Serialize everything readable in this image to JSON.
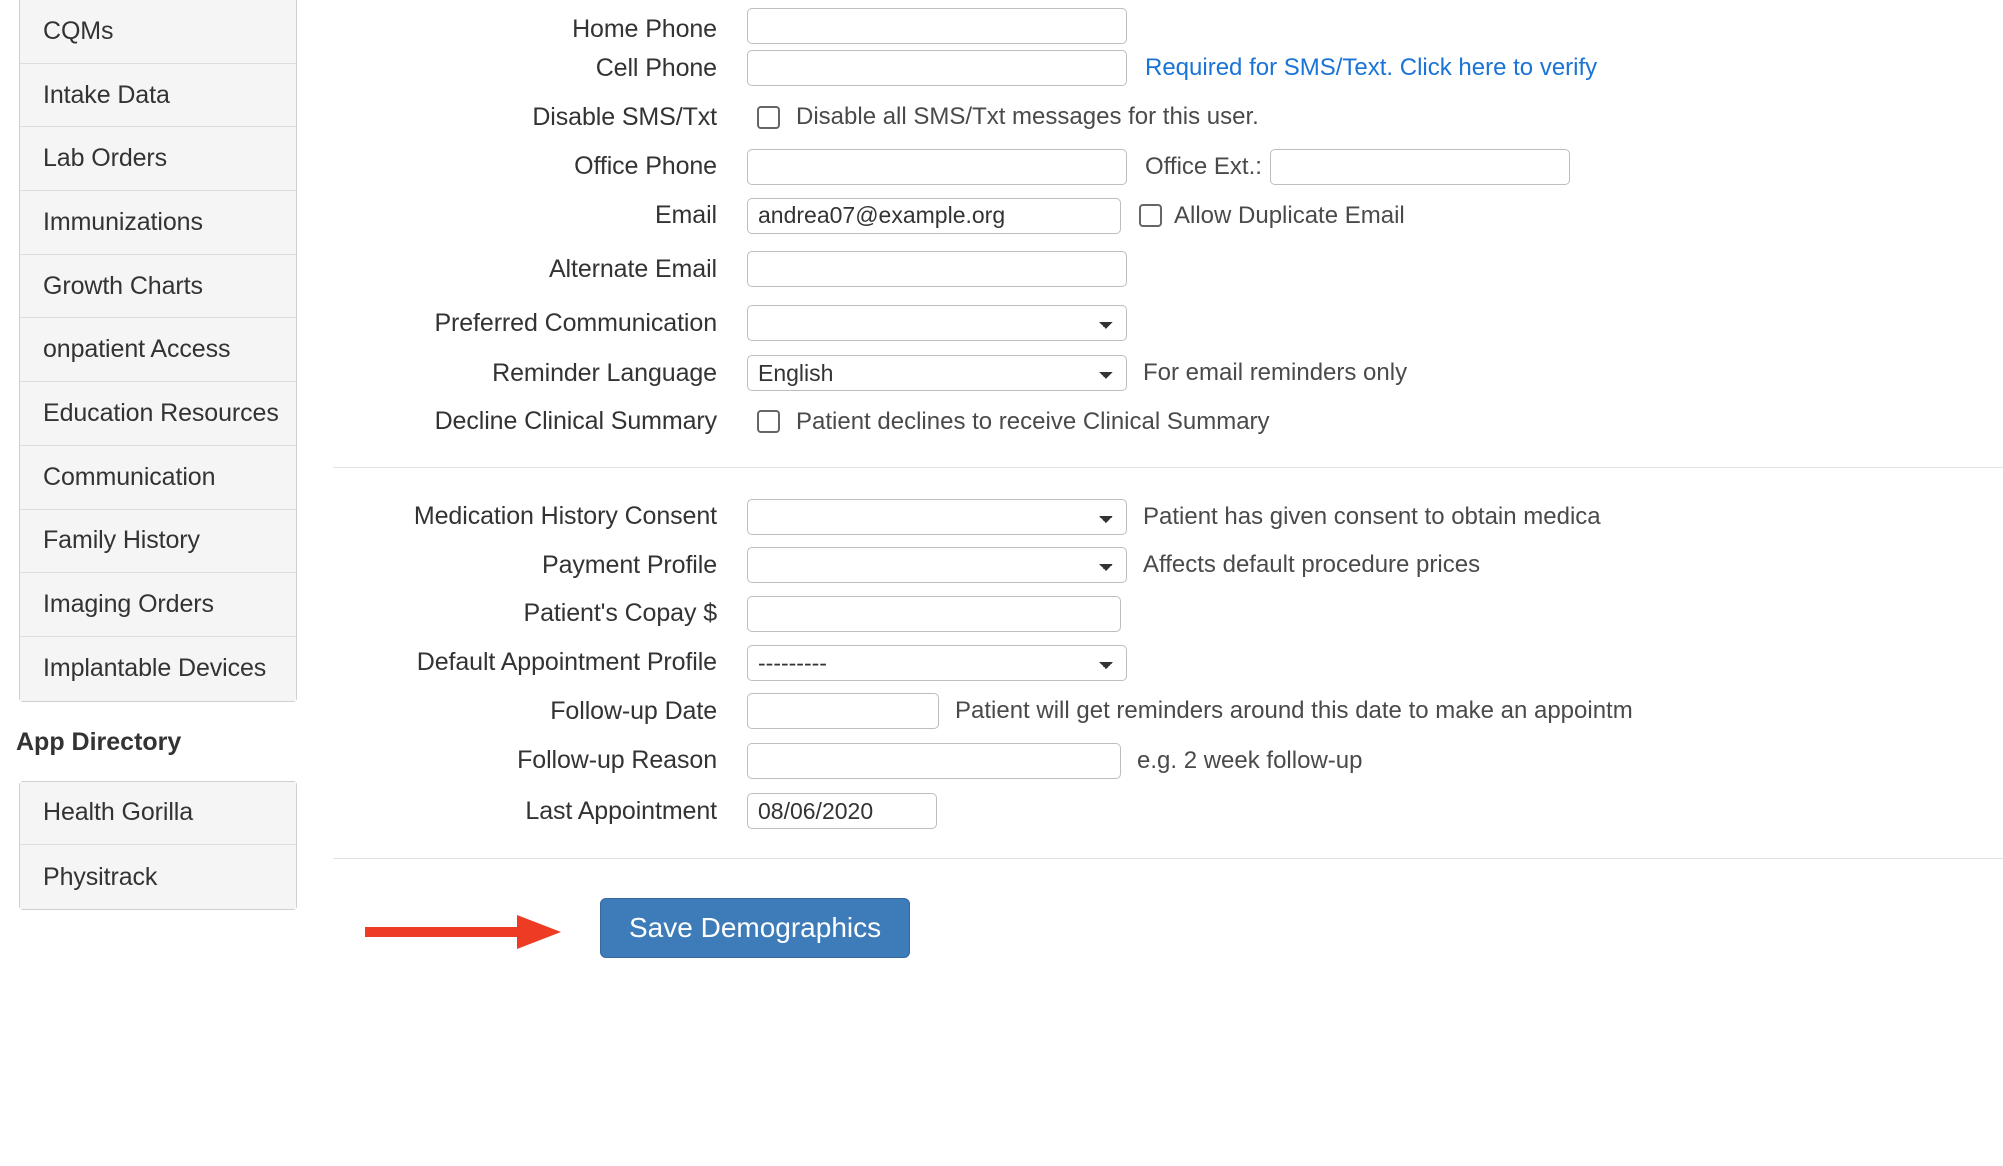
{
  "sidebar": {
    "nav_items": [
      {
        "label": "CQMs"
      },
      {
        "label": "Intake Data"
      },
      {
        "label": "Lab Orders"
      },
      {
        "label": "Immunizations"
      },
      {
        "label": "Growth Charts"
      },
      {
        "label": "onpatient Access"
      },
      {
        "label": "Education Resources"
      },
      {
        "label": "Communication"
      },
      {
        "label": "Family History"
      },
      {
        "label": "Imaging Orders"
      },
      {
        "label": "Implantable Devices"
      }
    ],
    "app_directory_title": "App Directory",
    "app_items": [
      {
        "label": "Health Gorilla"
      },
      {
        "label": "Physitrack"
      }
    ]
  },
  "form": {
    "home_phone": {
      "label": "Home Phone",
      "value": "",
      "placeholder": ""
    },
    "cell_phone": {
      "label": "Cell Phone",
      "value": "",
      "placeholder": "",
      "link": "Required for SMS/Text. Click here to verify"
    },
    "disable_sms": {
      "label": "Disable SMS/Txt",
      "checkbox_label": "Disable all SMS/Txt messages for this user.",
      "checked": false
    },
    "office_phone": {
      "label": "Office Phone",
      "value": "",
      "ext_label": "Office Ext.:",
      "ext_value": ""
    },
    "email": {
      "label": "Email",
      "value": "andrea07@example.org",
      "duplicate_label": "Allow Duplicate Email",
      "duplicate_checked": false
    },
    "alternate_email": {
      "label": "Alternate Email",
      "value": ""
    },
    "preferred_communication": {
      "label": "Preferred Communication",
      "value": "",
      "options": [
        ""
      ]
    },
    "reminder_language": {
      "label": "Reminder Language",
      "value": "English",
      "options": [
        "English"
      ],
      "hint": "For email reminders only"
    },
    "decline_clinical_summary": {
      "label": "Decline Clinical Summary",
      "checkbox_label": "Patient declines to receive Clinical Summary",
      "checked": false
    },
    "medication_history_consent": {
      "label": "Medication History Consent",
      "value": "",
      "options": [
        ""
      ],
      "hint": "Patient has given consent to obtain medica"
    },
    "payment_profile": {
      "label": "Payment Profile",
      "value": "",
      "options": [
        ""
      ],
      "hint": "Affects default procedure prices"
    },
    "patient_copay": {
      "label": "Patient's Copay $",
      "value": ""
    },
    "default_appointment_profile": {
      "label": "Default Appointment Profile",
      "value": "---------",
      "options": [
        "---------"
      ]
    },
    "follow_up_date": {
      "label": "Follow-up Date",
      "value": "",
      "hint": "Patient will get reminders around this date to make an appointm"
    },
    "follow_up_reason": {
      "label": "Follow-up Reason",
      "value": "",
      "hint": "e.g. 2 week follow-up"
    },
    "last_appointment": {
      "label": "Last Appointment",
      "value": "08/06/2020"
    }
  },
  "footer": {
    "save_label": "Save Demographics",
    "arrow_color": "#ee3b24"
  }
}
